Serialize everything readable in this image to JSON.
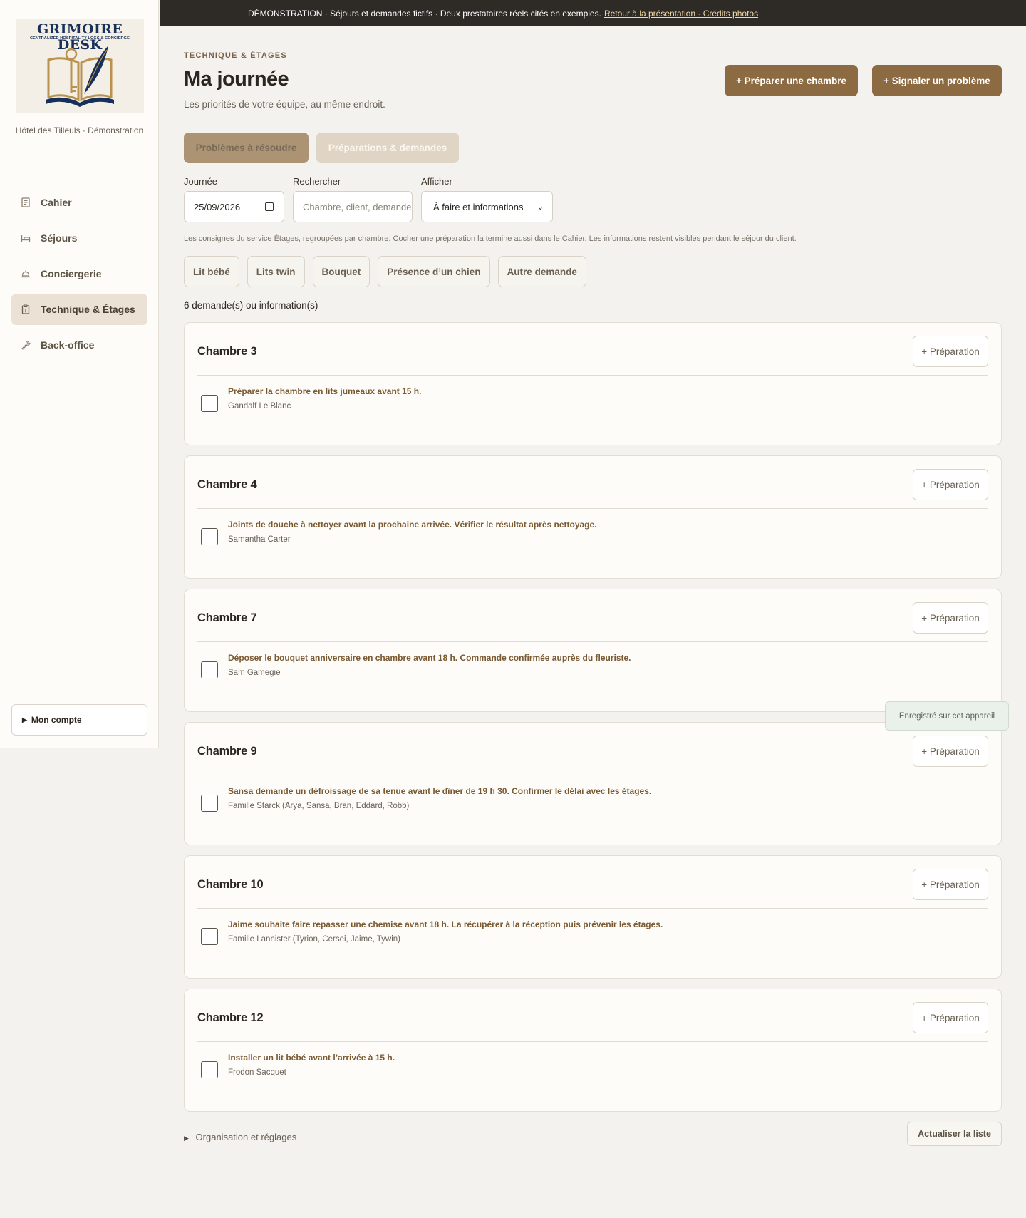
{
  "app": {
    "logo_title": "GRIMOIRE DESK",
    "logo_subtitle": "CENTRALIZED HOSPITALITY LOGS & CONCIERGE",
    "hotel_name": "Hôtel des Tilleuls · Démonstration"
  },
  "sidebar": {
    "items": [
      {
        "label": "Cahier",
        "icon": "notebook-icon"
      },
      {
        "label": "Séjours",
        "icon": "bed-icon"
      },
      {
        "label": "Conciergerie",
        "icon": "service-bell-icon"
      },
      {
        "label": "Technique & Étages",
        "icon": "clipboard-icon",
        "active": true
      },
      {
        "label": "Back-office",
        "icon": "wrench-icon"
      }
    ],
    "account_label": "Mon compte"
  },
  "banner": {
    "text": "DÉMONSTRATION · Séjours et demandes fictifs · Deux prestataires réels cités en exemples.",
    "link_text": "Retour à la présentation · Crédits photos"
  },
  "header": {
    "eyebrow": "TECHNIQUE & ÉTAGES",
    "title": "Ma journée",
    "subtitle": "Les priorités de votre équipe, au même endroit.",
    "btn_prepare": "+ Préparer une chambre",
    "btn_report": "+ Signaler un problème"
  },
  "tabs": {
    "problems": "Problèmes à résoudre",
    "preparations": "Préparations & demandes"
  },
  "filters": {
    "date_label": "Journée",
    "date_value": "25/09/2026",
    "search_label": "Rechercher",
    "search_placeholder": "Chambre, client, demande",
    "show_label": "Afficher",
    "show_value": "À faire et informations"
  },
  "hint": "Les consignes du service Étages, regroupées par chambre. Cocher une préparation la termine aussi dans le Cahier. Les informations restent visibles pendant le séjour du client.",
  "chips": [
    "Lit bébé",
    "Lits twin",
    "Bouquet",
    "Présence d’un chien",
    "Autre demande"
  ],
  "count_text": "6 demande(s) ou information(s)",
  "card_button_label": "+ Préparation",
  "rooms": [
    {
      "title": "Chambre 3",
      "task": "Préparer la chambre en lits jumeaux avant 15 h.",
      "who": "Gandalf Le Blanc"
    },
    {
      "title": "Chambre 4",
      "task": "Joints de douche à nettoyer avant la prochaine arrivée. Vérifier le résultat après nettoyage.",
      "who": "Samantha Carter"
    },
    {
      "title": "Chambre 7",
      "task": "Déposer le bouquet anniversaire en chambre avant 18 h. Commande confirmée auprès du fleuriste.",
      "who": "Sam Gamegie"
    },
    {
      "title": "Chambre 9",
      "task": "Sansa demande un défroissage de sa tenue avant le dîner de 19 h 30. Confirmer le délai avec les étages.",
      "who": "Famille Starck (Arya, Sansa, Bran, Eddard, Robb)"
    },
    {
      "title": "Chambre 10",
      "task": "Jaime souhaite faire repasser une chemise avant 18 h. La récupérer à la réception puis prévenir les étages.",
      "who": "Famille Lannister (Tyrion, Cersei, Jaime, Tywin)"
    },
    {
      "title": "Chambre 12",
      "task": "Installer un lit bébé avant l’arrivée à 15 h.",
      "who": "Frodon Sacquet"
    }
  ],
  "toast": "Enregistré sur cet appareil",
  "footer": {
    "settings_label": "Organisation et réglages",
    "refresh_label": "Actualiser la liste"
  },
  "colors": {
    "accent": "#8c6a42",
    "banner_bg": "#2e2b27",
    "active_nav": "#ebe2d5"
  }
}
